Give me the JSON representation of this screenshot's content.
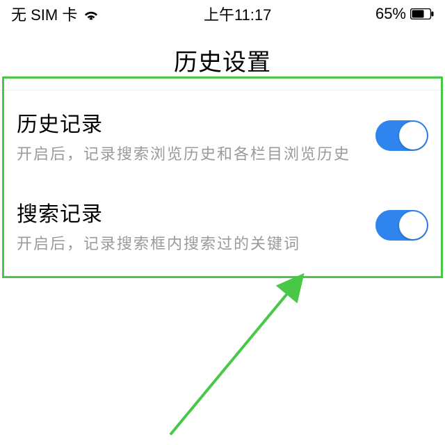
{
  "status": {
    "carrier": "无 SIM 卡",
    "time": "上午11:17",
    "battery_pct": "65%"
  },
  "page": {
    "title": "历史设置"
  },
  "settings": [
    {
      "key": "history_record",
      "title": "历史记录",
      "desc": "开启后，记录搜索浏览历史和各栏目浏览历史",
      "on": true
    },
    {
      "key": "search_record",
      "title": "搜索记录",
      "desc": "开启后，记录搜索框内搜索过的关键词",
      "on": true
    }
  ],
  "annotation": {
    "highlight_color": "#49c848",
    "arrow_color": "#49c848"
  }
}
